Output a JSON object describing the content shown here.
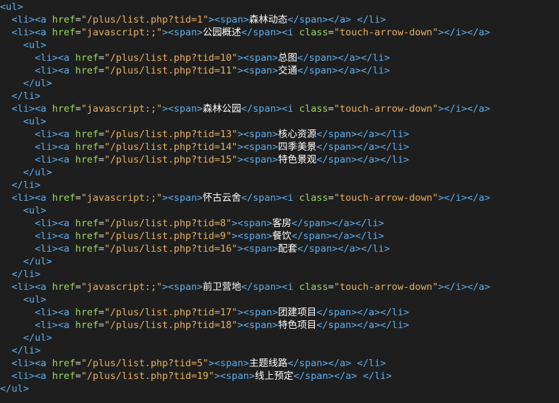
{
  "editor": {
    "lines": [
      {
        "indent": 0,
        "tokens": [
          {
            "k": "t",
            "v": "<ul>"
          }
        ]
      },
      {
        "indent": 1,
        "tokens": [
          {
            "k": "t",
            "v": "<li><a "
          },
          {
            "k": "a",
            "v": "href"
          },
          {
            "k": "e",
            "v": "="
          },
          {
            "k": "s",
            "v": "\"/plus/list.php?tid=1\""
          },
          {
            "k": "t",
            "v": "><span>"
          },
          {
            "k": "c",
            "v": "森林动态"
          },
          {
            "k": "t",
            "v": "</span></a> </li>"
          }
        ]
      },
      {
        "indent": 1,
        "tokens": [
          {
            "k": "t",
            "v": "<li><a "
          },
          {
            "k": "a",
            "v": "href"
          },
          {
            "k": "e",
            "v": "="
          },
          {
            "k": "s",
            "v": "\"javascript:;\""
          },
          {
            "k": "t",
            "v": "><span>"
          },
          {
            "k": "c",
            "v": "公园概述"
          },
          {
            "k": "t",
            "v": "</span><i "
          },
          {
            "k": "a",
            "v": "class"
          },
          {
            "k": "e",
            "v": "="
          },
          {
            "k": "s",
            "v": "\"touch-arrow-down\""
          },
          {
            "k": "t",
            "v": "></i></a>"
          }
        ]
      },
      {
        "indent": 2,
        "tokens": [
          {
            "k": "t",
            "v": "<ul>"
          }
        ]
      },
      {
        "indent": 3,
        "tokens": [
          {
            "k": "t",
            "v": "<li><a "
          },
          {
            "k": "a",
            "v": "href"
          },
          {
            "k": "e",
            "v": "="
          },
          {
            "k": "s",
            "v": "\"/plus/list.php?tid=10\""
          },
          {
            "k": "t",
            "v": "><span>"
          },
          {
            "k": "c",
            "v": "总图"
          },
          {
            "k": "t",
            "v": "</span></a></li>"
          }
        ]
      },
      {
        "indent": 3,
        "tokens": [
          {
            "k": "t",
            "v": "<li><a "
          },
          {
            "k": "a",
            "v": "href"
          },
          {
            "k": "e",
            "v": "="
          },
          {
            "k": "s",
            "v": "\"/plus/list.php?tid=11\""
          },
          {
            "k": "t",
            "v": "><span>"
          },
          {
            "k": "c",
            "v": "交通"
          },
          {
            "k": "t",
            "v": "</span></a></li>"
          }
        ]
      },
      {
        "indent": 2,
        "tokens": [
          {
            "k": "t",
            "v": "</ul>"
          }
        ]
      },
      {
        "indent": 1,
        "tokens": [
          {
            "k": "t",
            "v": "</li>"
          }
        ]
      },
      {
        "indent": 1,
        "tokens": [
          {
            "k": "t",
            "v": "<li><a "
          },
          {
            "k": "a",
            "v": "href"
          },
          {
            "k": "e",
            "v": "="
          },
          {
            "k": "s",
            "v": "\"javascript:;\""
          },
          {
            "k": "t",
            "v": "><span>"
          },
          {
            "k": "c",
            "v": "森林公园"
          },
          {
            "k": "t",
            "v": "</span><i "
          },
          {
            "k": "a",
            "v": "class"
          },
          {
            "k": "e",
            "v": "="
          },
          {
            "k": "s",
            "v": "\"touch-arrow-down\""
          },
          {
            "k": "t",
            "v": "></i></a>"
          }
        ]
      },
      {
        "indent": 2,
        "tokens": [
          {
            "k": "t",
            "v": "<ul>"
          }
        ]
      },
      {
        "indent": 3,
        "tokens": [
          {
            "k": "t",
            "v": "<li><a "
          },
          {
            "k": "a",
            "v": "href"
          },
          {
            "k": "e",
            "v": "="
          },
          {
            "k": "s",
            "v": "\"/plus/list.php?tid=13\""
          },
          {
            "k": "t",
            "v": "><span>"
          },
          {
            "k": "c",
            "v": "核心资源"
          },
          {
            "k": "t",
            "v": "</span></a></li>"
          }
        ]
      },
      {
        "indent": 3,
        "tokens": [
          {
            "k": "t",
            "v": "<li><a "
          },
          {
            "k": "a",
            "v": "href"
          },
          {
            "k": "e",
            "v": "="
          },
          {
            "k": "s",
            "v": "\"/plus/list.php?tid=14\""
          },
          {
            "k": "t",
            "v": "><span>"
          },
          {
            "k": "c",
            "v": "四季美景"
          },
          {
            "k": "t",
            "v": "</span></a></li>"
          }
        ]
      },
      {
        "indent": 3,
        "tokens": [
          {
            "k": "t",
            "v": "<li><a "
          },
          {
            "k": "a",
            "v": "href"
          },
          {
            "k": "e",
            "v": "="
          },
          {
            "k": "s",
            "v": "\"/plus/list.php?tid=15\""
          },
          {
            "k": "t",
            "v": "><span>"
          },
          {
            "k": "c",
            "v": "特色景观"
          },
          {
            "k": "t",
            "v": "</span></a></li>"
          }
        ]
      },
      {
        "indent": 2,
        "tokens": [
          {
            "k": "t",
            "v": "</ul>"
          }
        ]
      },
      {
        "indent": 1,
        "tokens": [
          {
            "k": "t",
            "v": "</li>"
          }
        ]
      },
      {
        "indent": 1,
        "tokens": [
          {
            "k": "t",
            "v": "<li><a "
          },
          {
            "k": "a",
            "v": "href"
          },
          {
            "k": "e",
            "v": "="
          },
          {
            "k": "s",
            "v": "\"javascript:;\""
          },
          {
            "k": "t",
            "v": "><span>"
          },
          {
            "k": "c",
            "v": "怀古云舍"
          },
          {
            "k": "t",
            "v": "</span><i "
          },
          {
            "k": "a",
            "v": "class"
          },
          {
            "k": "e",
            "v": "="
          },
          {
            "k": "s",
            "v": "\"touch-arrow-down\""
          },
          {
            "k": "t",
            "v": "></i></a>"
          }
        ]
      },
      {
        "indent": 2,
        "tokens": [
          {
            "k": "t",
            "v": "<ul>"
          }
        ]
      },
      {
        "indent": 3,
        "tokens": [
          {
            "k": "t",
            "v": "<li><a "
          },
          {
            "k": "a",
            "v": "href"
          },
          {
            "k": "e",
            "v": "="
          },
          {
            "k": "s",
            "v": "\"/plus/list.php?tid=8\""
          },
          {
            "k": "t",
            "v": "><span>"
          },
          {
            "k": "c",
            "v": "客房"
          },
          {
            "k": "t",
            "v": "</span></a></li>"
          }
        ]
      },
      {
        "indent": 3,
        "tokens": [
          {
            "k": "t",
            "v": "<li><a "
          },
          {
            "k": "a",
            "v": "href"
          },
          {
            "k": "e",
            "v": "="
          },
          {
            "k": "s",
            "v": "\"/plus/list.php?tid=9\""
          },
          {
            "k": "t",
            "v": "><span>"
          },
          {
            "k": "c",
            "v": "餐饮"
          },
          {
            "k": "t",
            "v": "</span></a></li>"
          }
        ]
      },
      {
        "indent": 3,
        "tokens": [
          {
            "k": "t",
            "v": "<li><a "
          },
          {
            "k": "a",
            "v": "href"
          },
          {
            "k": "e",
            "v": "="
          },
          {
            "k": "s",
            "v": "\"/plus/list.php?tid=16\""
          },
          {
            "k": "t",
            "v": "><span>"
          },
          {
            "k": "c",
            "v": "配套"
          },
          {
            "k": "t",
            "v": "</span></a></li>"
          }
        ]
      },
      {
        "indent": 2,
        "tokens": [
          {
            "k": "t",
            "v": "</ul>"
          }
        ]
      },
      {
        "indent": 1,
        "tokens": [
          {
            "k": "t",
            "v": "</li>"
          }
        ]
      },
      {
        "indent": 1,
        "tokens": [
          {
            "k": "t",
            "v": "<li><a "
          },
          {
            "k": "a",
            "v": "href"
          },
          {
            "k": "e",
            "v": "="
          },
          {
            "k": "s",
            "v": "\"javascript:;\""
          },
          {
            "k": "t",
            "v": "><span>"
          },
          {
            "k": "c",
            "v": "前卫营地"
          },
          {
            "k": "t",
            "v": "</span><i "
          },
          {
            "k": "a",
            "v": "class"
          },
          {
            "k": "e",
            "v": "="
          },
          {
            "k": "s",
            "v": "\"touch-arrow-down\""
          },
          {
            "k": "t",
            "v": "></i></a>"
          }
        ]
      },
      {
        "indent": 2,
        "tokens": [
          {
            "k": "t",
            "v": "<ul>"
          }
        ]
      },
      {
        "indent": 3,
        "tokens": [
          {
            "k": "t",
            "v": "<li><a "
          },
          {
            "k": "a",
            "v": "href"
          },
          {
            "k": "e",
            "v": "="
          },
          {
            "k": "s",
            "v": "\"/plus/list.php?tid=17\""
          },
          {
            "k": "t",
            "v": "><span>"
          },
          {
            "k": "c",
            "v": "团建项目"
          },
          {
            "k": "t",
            "v": "</span></a></li>"
          }
        ]
      },
      {
        "indent": 3,
        "tokens": [
          {
            "k": "t",
            "v": "<li><a "
          },
          {
            "k": "a",
            "v": "href"
          },
          {
            "k": "e",
            "v": "="
          },
          {
            "k": "s",
            "v": "\"/plus/list.php?tid=18\""
          },
          {
            "k": "t",
            "v": "><span>"
          },
          {
            "k": "c",
            "v": "特色项目"
          },
          {
            "k": "t",
            "v": "</span></a></li>"
          }
        ]
      },
      {
        "indent": 2,
        "tokens": [
          {
            "k": "t",
            "v": "</ul>"
          }
        ]
      },
      {
        "indent": 1,
        "tokens": [
          {
            "k": "t",
            "v": "</li>"
          }
        ]
      },
      {
        "indent": 1,
        "tokens": [
          {
            "k": "t",
            "v": "<li><a "
          },
          {
            "k": "a",
            "v": "href"
          },
          {
            "k": "e",
            "v": "="
          },
          {
            "k": "s",
            "v": "\"/plus/list.php?tid=5\""
          },
          {
            "k": "t",
            "v": "><span>"
          },
          {
            "k": "c",
            "v": "主题线路"
          },
          {
            "k": "t",
            "v": "</span></a> </li>"
          }
        ]
      },
      {
        "indent": 1,
        "tokens": [
          {
            "k": "t",
            "v": "<li><a "
          },
          {
            "k": "a",
            "v": "href"
          },
          {
            "k": "e",
            "v": "="
          },
          {
            "k": "s",
            "v": "\"/plus/list.php?tid=19\""
          },
          {
            "k": "t",
            "v": "><span>"
          },
          {
            "k": "c",
            "v": "线上预定"
          },
          {
            "k": "t",
            "v": "</span></a> </li>"
          }
        ]
      },
      {
        "indent": 0,
        "tokens": [
          {
            "k": "t",
            "v": "</ul>"
          }
        ]
      }
    ]
  },
  "colors": {
    "background": "#1e1e1e",
    "tag": "#5bb0f0",
    "attribute": "#9cdc58",
    "string": "#e8b060",
    "text": "#ffffff"
  }
}
